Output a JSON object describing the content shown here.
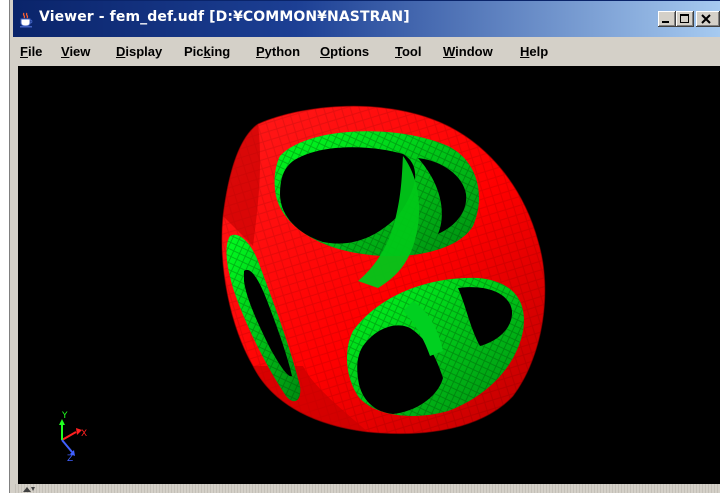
{
  "window": {
    "title": "Viewer - fem_def.udf [D:¥COMMON¥NASTRAN]",
    "controls": {
      "minimize": "minimize",
      "maximize": "maximize",
      "close": "close"
    }
  },
  "menu": [
    {
      "label": "File",
      "mnemonic": "F",
      "rest": "ile"
    },
    {
      "label": "View",
      "mnemonic": "V",
      "rest": "iew"
    },
    {
      "label": "Display",
      "mnemonic": "D",
      "rest": "isplay"
    },
    {
      "label": "Picking",
      "pre": "Pic",
      "mnemonic": "k",
      "rest": "ing"
    },
    {
      "label": "Python",
      "mnemonic": "P",
      "rest": "ython"
    },
    {
      "label": "Options",
      "mnemonic": "O",
      "rest": "ptions"
    },
    {
      "label": "Tool",
      "mnemonic": "T",
      "rest": "ool"
    },
    {
      "label": "Window",
      "mnemonic": "W",
      "rest": "indow"
    },
    {
      "label": "Help",
      "mnemonic": "H",
      "rest": "elp"
    }
  ],
  "viewport": {
    "background": "#000000",
    "model": {
      "outer_color": "#ff0000",
      "inner_color": "#00dd00",
      "shading": "faceted"
    },
    "axes": {
      "x_label": "X",
      "y_label": "Y",
      "z_label": "Z",
      "x_color": "#ff2020",
      "y_color": "#20ff20",
      "z_color": "#4060ff"
    }
  },
  "colors": {
    "titlebar_start": "#0a246a",
    "titlebar_end": "#a6caf0",
    "chrome": "#d4d0c8"
  }
}
